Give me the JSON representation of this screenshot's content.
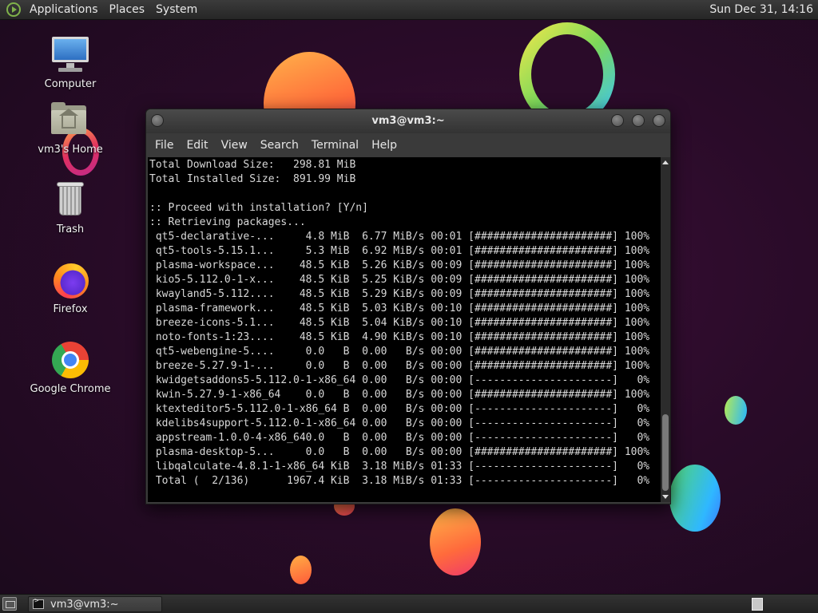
{
  "top_panel": {
    "menus": [
      "Applications",
      "Places",
      "System"
    ],
    "clock": "Sun Dec 31, 14:16"
  },
  "desktop_icons": [
    {
      "label": "Computer",
      "icon": "computer-icon"
    },
    {
      "label": "vm3's Home",
      "icon": "home-folder-icon"
    },
    {
      "label": "Trash",
      "icon": "trash-icon"
    },
    {
      "label": "Firefox",
      "icon": "firefox-icon"
    },
    {
      "label": "Google Chrome",
      "icon": "chrome-icon"
    }
  ],
  "window": {
    "title": "vm3@vm3:~",
    "menus": [
      "File",
      "Edit",
      "View",
      "Search",
      "Terminal",
      "Help"
    ],
    "terminal_lines": [
      "Total Download Size:   298.81 MiB",
      "Total Installed Size:  891.99 MiB",
      "",
      ":: Proceed with installation? [Y/n]",
      ":: Retrieving packages...",
      " qt5-declarative-...     4.8 MiB  6.77 MiB/s 00:01 [######################] 100%",
      " qt5-tools-5.15.1...     5.3 MiB  6.92 MiB/s 00:01 [######################] 100%",
      " plasma-workspace...    48.5 KiB  5.26 KiB/s 00:09 [######################] 100%",
      " kio5-5.112.0-1-x...    48.5 KiB  5.25 KiB/s 00:09 [######################] 100%",
      " kwayland5-5.112....    48.5 KiB  5.29 KiB/s 00:09 [######################] 100%",
      " plasma-framework...    48.5 KiB  5.03 KiB/s 00:10 [######################] 100%",
      " breeze-icons-5.1...    48.5 KiB  5.04 KiB/s 00:10 [######################] 100%",
      " noto-fonts-1:23....    48.5 KiB  4.90 KiB/s 00:10 [######################] 100%",
      " qt5-webengine-5....     0.0   B  0.00   B/s 00:00 [######################] 100%",
      " breeze-5.27.9-1-...     0.0   B  0.00   B/s 00:00 [######################] 100%",
      " kwidgetsaddons5-5.112.0-1-x86_64 0.00   B/s 00:00 [----------------------]   0%",
      " kwin-5.27.9-1-x86_64    0.0   B  0.00   B/s 00:00 [######################] 100%",
      " ktexteditor5-5.112.0-1-x86_64 B  0.00   B/s 00:00 [----------------------]   0%",
      " kdelibs4support-5.112.0-1-x86_64 0.00   B/s 00:00 [----------------------]   0%",
      " appstream-1.0.0-4-x86_640.0   B  0.00   B/s 00:00 [----------------------]   0%",
      " plasma-desktop-5...     0.0   B  0.00   B/s 00:00 [######################] 100%",
      " libqalculate-4.8.1-1-x86_64 KiB  3.18 MiB/s 01:33 [----------------------]   0%",
      " Total (  2/136)      1967.4 KiB  3.18 MiB/s 01:33 [----------------------]   0%"
    ]
  },
  "taskbar": {
    "task_label": "vm3@vm3:~"
  }
}
